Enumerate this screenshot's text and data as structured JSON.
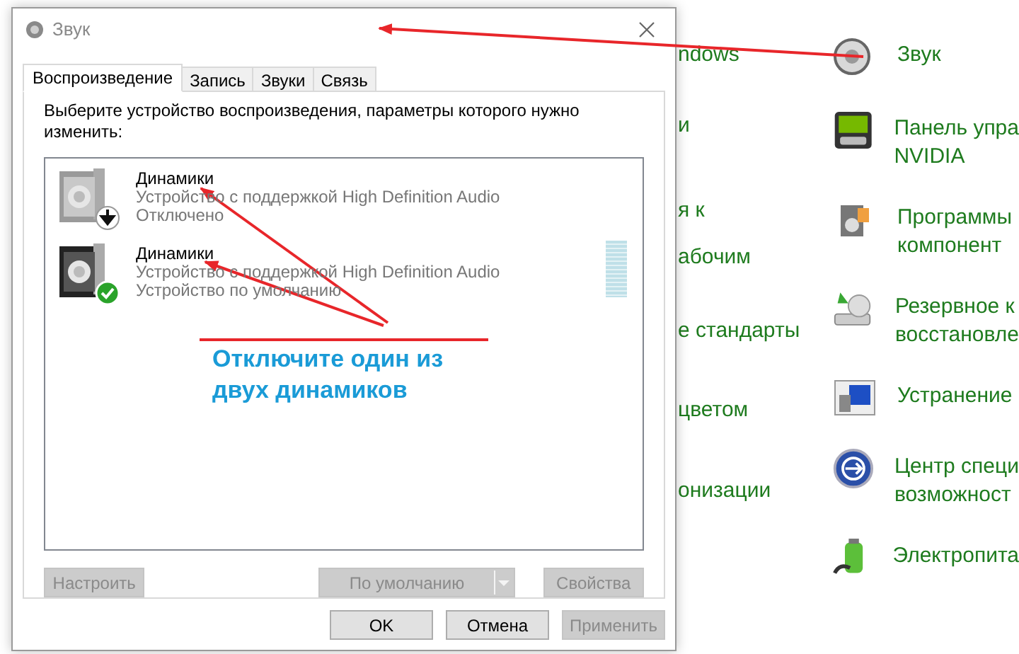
{
  "background_panel": {
    "left_column_fragments": [
      "ndows",
      "и",
      "я к",
      "абочим",
      "е стандарты",
      "цветом",
      "онизации"
    ],
    "items": [
      {
        "kind": "speaker",
        "lines": [
          "Звук"
        ]
      },
      {
        "kind": "nvidia",
        "lines": [
          "Панель упра",
          "NVIDIA"
        ]
      },
      {
        "kind": "programs",
        "lines": [
          "Программы",
          "компонент"
        ]
      },
      {
        "kind": "backup",
        "lines": [
          "Резервное к",
          "восстановле"
        ]
      },
      {
        "kind": "troubleshoot",
        "lines": [
          "Устранение"
        ]
      },
      {
        "kind": "access",
        "lines": [
          "Центр специ",
          "возможност"
        ]
      },
      {
        "kind": "power",
        "lines": [
          "Электропита"
        ]
      }
    ]
  },
  "window": {
    "title": "Звук"
  },
  "tabs": [
    {
      "label": "Воспроизведение",
      "selected": true
    },
    {
      "label": "Запись",
      "selected": false
    },
    {
      "label": "Звуки",
      "selected": false
    },
    {
      "label": "Связь",
      "selected": false
    }
  ],
  "instruction": "Выберите устройство воспроизведения, параметры которого нужно изменить:",
  "devices": [
    {
      "name": "Динамики",
      "description": "Устройство с поддержкой High Definition Audio",
      "status": "Отключено",
      "kind": "disabled"
    },
    {
      "name": "Динамики",
      "description": "Устройство с поддержкой High Definition Audio",
      "status": "Устройство по умолчанию",
      "kind": "default",
      "level": 0
    }
  ],
  "panel_buttons": [
    {
      "label": "Настроить",
      "disabled": true,
      "kind": "plain"
    },
    {
      "label": "По умолчанию",
      "disabled": true,
      "kind": "split"
    },
    {
      "label": "Свойства",
      "disabled": true,
      "kind": "plain"
    }
  ],
  "dialog_buttons": [
    {
      "label": "OK",
      "disabled": false
    },
    {
      "label": "Отмена",
      "disabled": false
    },
    {
      "label": "Применить",
      "disabled": true
    }
  ],
  "annotation": {
    "text": "Отключите один из двух динамиков"
  }
}
